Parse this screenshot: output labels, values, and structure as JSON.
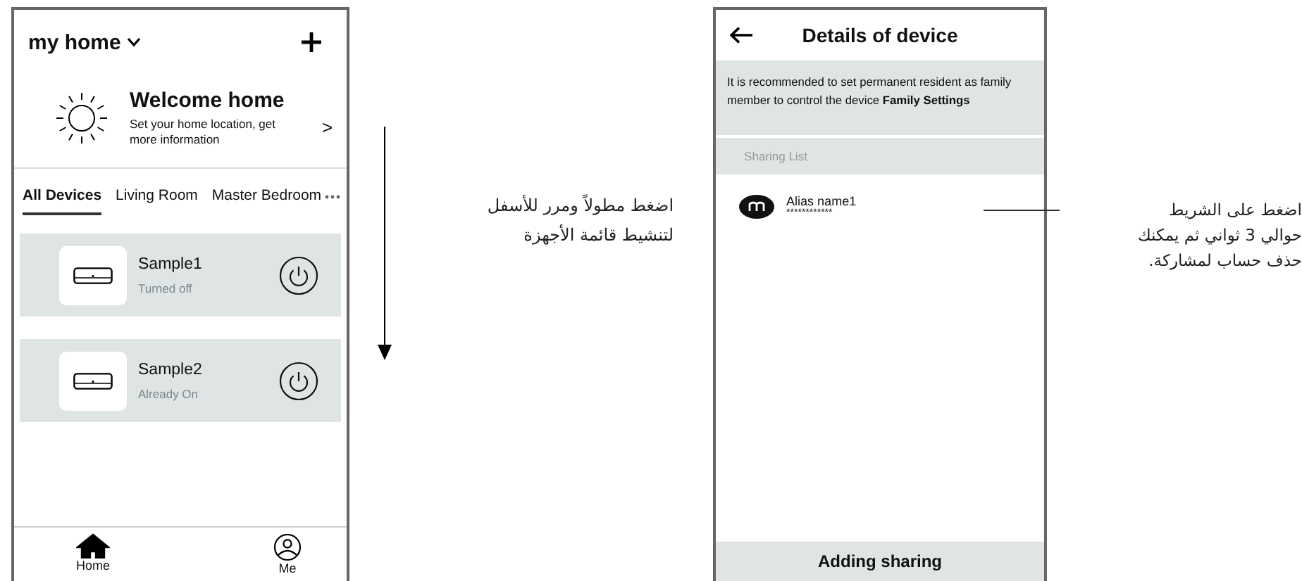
{
  "home_screen": {
    "title": "my home",
    "welcome": {
      "heading": "Welcome home",
      "text": "Set your home location, get more information",
      "arrow": ">"
    },
    "tabs": [
      {
        "label": "All Devices",
        "selected": true
      },
      {
        "label": "Living Room",
        "selected": false
      },
      {
        "label": "Master Bedroom",
        "selected": false
      }
    ],
    "devices": [
      {
        "name": "Sample1",
        "status": "Turned off"
      },
      {
        "name": "Sample2",
        "status": "Already On"
      }
    ],
    "nav": [
      {
        "label": "Home",
        "kind": "home",
        "selected": true
      },
      {
        "label": "Me",
        "kind": "profile",
        "selected": false
      }
    ]
  },
  "left_note": {
    "lines": [
      "اضغط مطولاً ومرر للأسفل",
      "لتنشيط قائمة الأجهزة"
    ]
  },
  "details_screen": {
    "title": "Details of device",
    "notice": "It is recommended to set permanent resident as family member to control the device **Family Settings**",
    "section": "Sharing List",
    "members": [
      {
        "name": "Alias name1",
        "account": "************"
      }
    ],
    "footer_button": "Adding sharing"
  },
  "right_note": {
    "lines": [
      "اضغط على الشريط",
      "حوالي 3 ثواني ثم يمكنك",
      "حذف حساب لمشاركة."
    ]
  }
}
